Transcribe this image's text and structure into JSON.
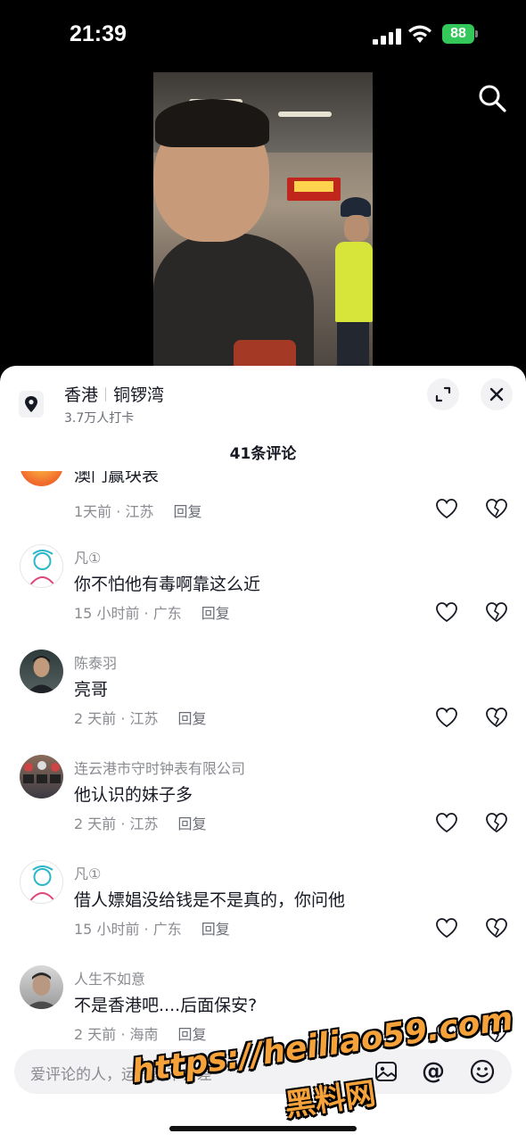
{
  "status_bar": {
    "time": "21:39",
    "battery": "88",
    "icons": [
      "signal-icon",
      "wifi-icon",
      "battery-icon"
    ]
  },
  "header": {
    "search_icon": "search-icon"
  },
  "location": {
    "city": "香港",
    "district": "铜锣湾",
    "checkins": "3.7万人打卡",
    "icons": [
      "location-pin-icon",
      "expand-icon",
      "close-icon"
    ]
  },
  "comments_header": {
    "title": "41条评论"
  },
  "comments": [
    {
      "name": "",
      "text": "澳门赢块表",
      "time": "1天前 · 江苏",
      "reply": "回复"
    },
    {
      "name": "凡①",
      "text": "你不怕他有毒啊靠这么近",
      "time": "15 小时前 · 广东",
      "reply": "回复"
    },
    {
      "name": "陈泰羽",
      "text": "亮哥",
      "time": "2 天前 · 江苏",
      "reply": "回复"
    },
    {
      "name": "连云港市守时钟表有限公司",
      "text": "他认识的妹子多",
      "time": "2 天前 · 江苏",
      "reply": "回复"
    },
    {
      "name": "凡①",
      "text": "借人嫖娼没给钱是不是真的，你问他",
      "time": "15 小时前 · 广东",
      "reply": "回复"
    },
    {
      "name": "人生不如意",
      "text": "不是香港吧....后面保安?",
      "time": "2 天前 · 海南",
      "reply": "回复"
    }
  ],
  "input": {
    "placeholder": "爱评论的人，运气都不会差",
    "icons": [
      "image-icon",
      "at-icon",
      "emoji-icon"
    ],
    "at_symbol": "@"
  },
  "watermark": {
    "url": "https://heiliao59.com",
    "text": "黑料网"
  },
  "colors": {
    "accent_battery": "#34c759",
    "watermark": "#f6a23a",
    "text_primary": "#161823",
    "text_secondary": "#8a8b91"
  }
}
